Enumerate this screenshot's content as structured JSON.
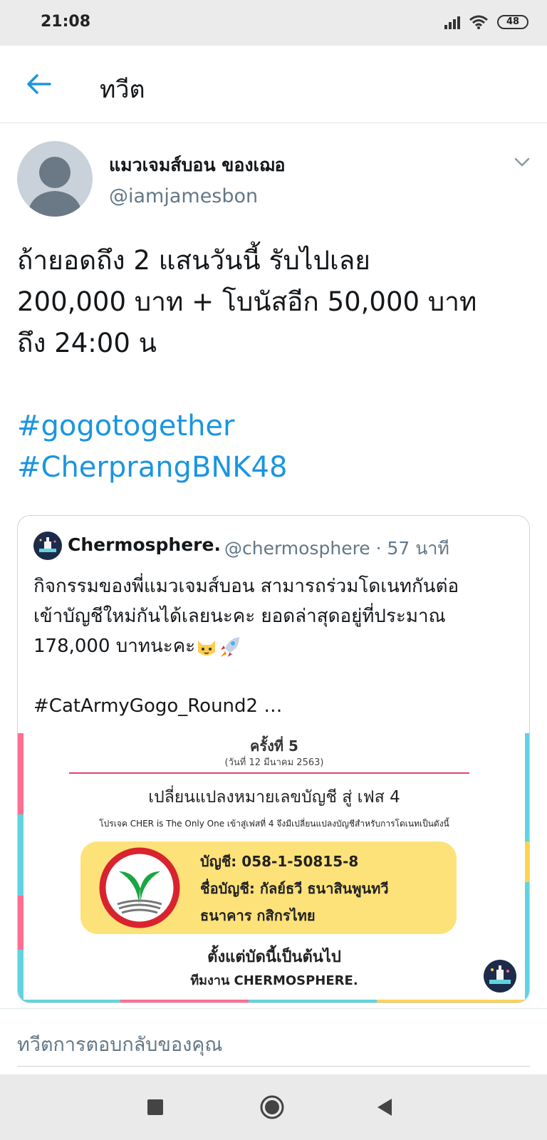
{
  "status_bar": {
    "time": "21:08",
    "battery": "48"
  },
  "header": {
    "title": "ทวีต"
  },
  "tweet": {
    "display_name": "แมวเจมส์บอน ของเฌอ",
    "handle": "@iamjamesbon",
    "text_lines": [
      "ถ้ายอดถึง 2 แสนวันนี้ รับไปเลย",
      "200,000 บาท + โบนัสอีก 50,000 บาท",
      "ถึง 24:00 น"
    ],
    "hashtags": [
      "#gogotogether",
      "#CherprangBNK48"
    ]
  },
  "quoted": {
    "name": "Chermosphere.",
    "meta": "@chermosphere · 57 นาที",
    "text_lines": [
      "กิจกรรมของพี่แมวเจมส์บอน สามารถร่วมโดเนทกันต่อ",
      "เข้าบัญชีใหม่กันได้เลยนะคะ ยอดล่าสุดอยู่ที่ประมาณ",
      "178,000 บาทนะคะ"
    ],
    "hashtag": "#CatArmyGogo_Round2 …",
    "image": {
      "round": "ครั้งที่ 5",
      "date": "(วันที่ 12 มีนาคม 2563)",
      "heading": "เปลี่ยนแปลงหมายเลขบัญชี สู่ เฟส 4",
      "sub": "โปรเจค CHER is The Only One เข้าสู่เฟสที่ 4 จึงมีเปลี่ยนแปลงบัญชีสำหรับการโดเนทเป็นดังนี้",
      "account": "บัญชี: 058-1-50815-8",
      "account_name": "ชื่อบัญชี: กัลย์ธวี ธนาสินพูนทวี",
      "bank": "ธนาคาร กสิกรไทย",
      "footer1": "ตั้งแต่บัดนี้เป็นต้นไป",
      "footer2": "ทีมงาน CHERMOSPHERE."
    }
  },
  "reply": {
    "placeholder": "ทวีตการตอบกลับของคุณ"
  },
  "colors": {
    "accent": "#1b95e0",
    "secondary_text": "#657786",
    "kbank_green": "#1aa642"
  },
  "icons": [
    "back-arrow-icon",
    "chevron-down-icon",
    "cat-emoji-icon",
    "rocket-emoji-icon",
    "recents-icon",
    "home-icon",
    "back-icon"
  ]
}
